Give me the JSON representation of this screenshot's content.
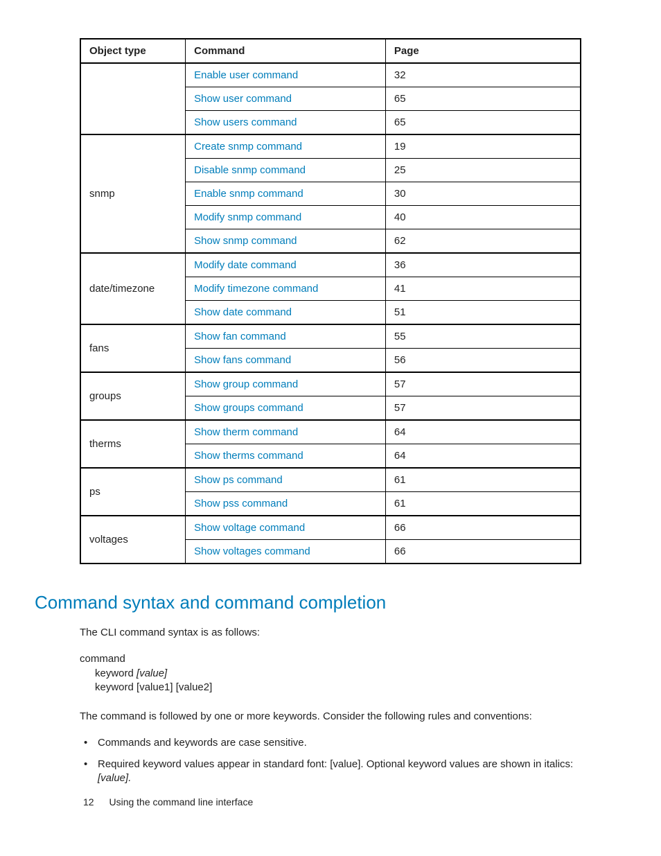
{
  "table": {
    "headers": {
      "objectType": "Object type",
      "command": "Command",
      "page": "Page"
    },
    "groups": [
      {
        "type": "",
        "rows": [
          {
            "cmd": "Enable user command",
            "page": "32"
          },
          {
            "cmd": "Show user command",
            "page": "65"
          },
          {
            "cmd": "Show users command",
            "page": "65"
          }
        ]
      },
      {
        "type": "snmp",
        "rows": [
          {
            "cmd": "Create snmp command",
            "page": "19"
          },
          {
            "cmd": "Disable snmp command",
            "page": "25"
          },
          {
            "cmd": "Enable snmp command",
            "page": "30"
          },
          {
            "cmd": "Modify snmp command",
            "page": "40"
          },
          {
            "cmd": "Show snmp command",
            "page": "62"
          }
        ]
      },
      {
        "type": "date/timezone",
        "rows": [
          {
            "cmd": "Modify date command",
            "page": "36"
          },
          {
            "cmd": "Modify timezone command",
            "page": "41"
          },
          {
            "cmd": "Show date command",
            "page": "51"
          }
        ]
      },
      {
        "type": "fans",
        "rows": [
          {
            "cmd": "Show fan command",
            "page": "55"
          },
          {
            "cmd": "Show fans command",
            "page": "56"
          }
        ]
      },
      {
        "type": "groups",
        "rows": [
          {
            "cmd": "Show group command",
            "page": "57"
          },
          {
            "cmd": "Show groups command",
            "page": "57"
          }
        ]
      },
      {
        "type": "therms",
        "rows": [
          {
            "cmd": "Show therm command",
            "page": "64"
          },
          {
            "cmd": "Show therms command",
            "page": "64"
          }
        ]
      },
      {
        "type": "ps",
        "rows": [
          {
            "cmd": "Show ps command",
            "page": "61"
          },
          {
            "cmd": "Show pss command",
            "page": "61"
          }
        ]
      },
      {
        "type": "voltages",
        "rows": [
          {
            "cmd": "Show voltage command",
            "page": "66"
          },
          {
            "cmd": "Show voltages command",
            "page": "66"
          }
        ]
      }
    ]
  },
  "section": {
    "heading": "Command syntax and command completion",
    "intro": "The CLI command syntax is as follows:",
    "syntax": {
      "line1": "command",
      "kw1a": "keyword ",
      "kw1b": "[value]",
      "kw2": "keyword [value1] [value2]"
    },
    "para2": "The command is followed by one or more keywords. Consider the following rules and conventions:",
    "bullets": [
      {
        "text": "Commands and keywords are case sensitive."
      },
      {
        "prefix": "Required keyword values appear in standard font: [value]. Optional keyword values are shown in italics: ",
        "italic": "[value].",
        "suffix": ""
      }
    ]
  },
  "footer": {
    "pageNumber": "12",
    "section": "Using the command line interface"
  }
}
